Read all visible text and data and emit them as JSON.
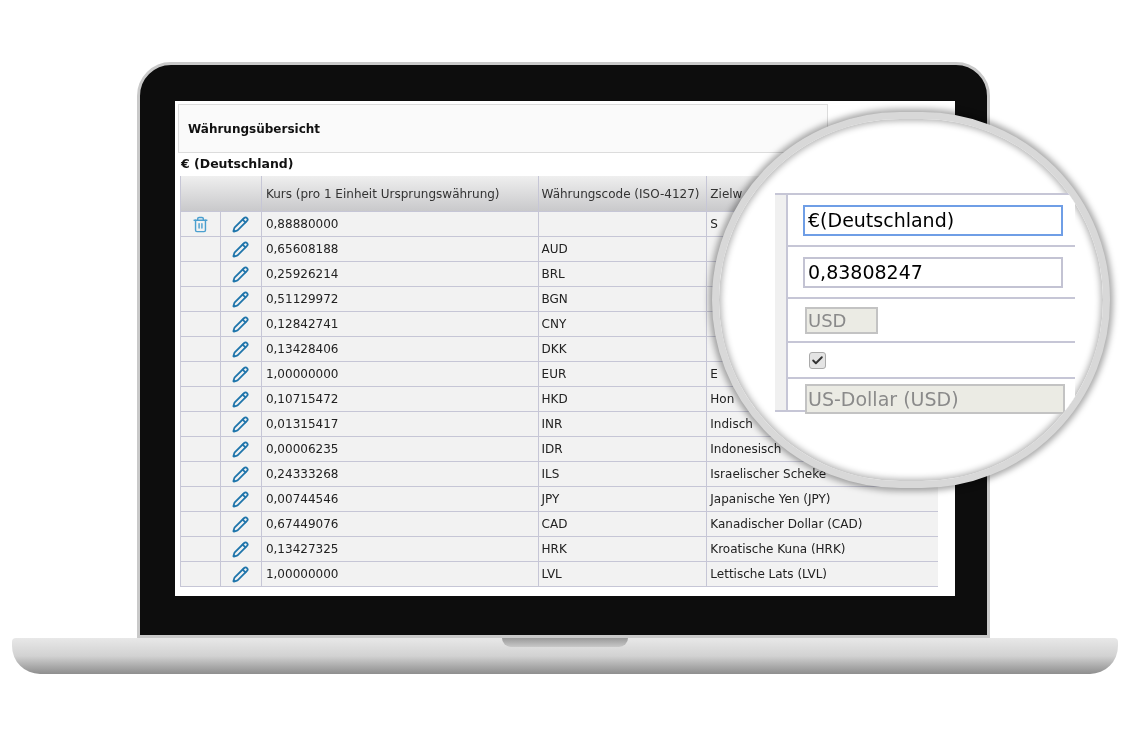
{
  "panel": {
    "title": "Währungsübersicht",
    "group": "€ (Deutschland)"
  },
  "table": {
    "columns": [
      "Kurs (pro 1 Einheit Ursprungswährung)",
      "Währungscode (ISO-4127)",
      "Zielw"
    ],
    "rows": [
      {
        "deletable": true,
        "rate": "0,88880000",
        "target": "S"
      },
      {
        "deletable": false,
        "rate": "0,65608188",
        "code": "AUD"
      },
      {
        "deletable": false,
        "rate": "0,25926214",
        "code": "BRL"
      },
      {
        "deletable": false,
        "rate": "0,51129972",
        "code": "BGN"
      },
      {
        "deletable": false,
        "rate": "0,12842741",
        "code": "CNY"
      },
      {
        "deletable": false,
        "rate": "0,13428406",
        "code": "DKK"
      },
      {
        "deletable": false,
        "rate": "1,00000000",
        "code": "EUR",
        "target": "E"
      },
      {
        "deletable": false,
        "rate": "0,10715472",
        "code": "HKD",
        "target": "Hon"
      },
      {
        "deletable": false,
        "rate": "0,01315417",
        "code": "INR",
        "target": "Indisch"
      },
      {
        "deletable": false,
        "rate": "0,00006235",
        "code": "IDR",
        "target": "Indonesisch"
      },
      {
        "deletable": false,
        "rate": "0,24333268",
        "code": "ILS",
        "target": "Israelischer Scheke"
      },
      {
        "deletable": false,
        "rate": "0,00744546",
        "code": "JPY",
        "target": "Japanische Yen (JPY)"
      },
      {
        "deletable": false,
        "rate": "0,67449076",
        "code": "CAD",
        "target": "Kanadischer Dollar (CAD)"
      },
      {
        "deletable": false,
        "rate": "0,13427325",
        "code": "HRK",
        "target": "Kroatische Kuna (HRK)"
      },
      {
        "deletable": false,
        "rate": "1,00000000",
        "code": "LVL",
        "target": "Lettische Lats (LVL)"
      }
    ]
  },
  "magnifier": {
    "fields": [
      {
        "kind": "text",
        "value": "€(Deutschland)",
        "focused": true
      },
      {
        "kind": "text",
        "value": "0,83808247",
        "focused": false
      },
      {
        "kind": "short",
        "value": "USD"
      },
      {
        "kind": "checkbox",
        "checked": true
      },
      {
        "kind": "readonly",
        "value": "US-Dollar (USD)"
      }
    ]
  }
}
